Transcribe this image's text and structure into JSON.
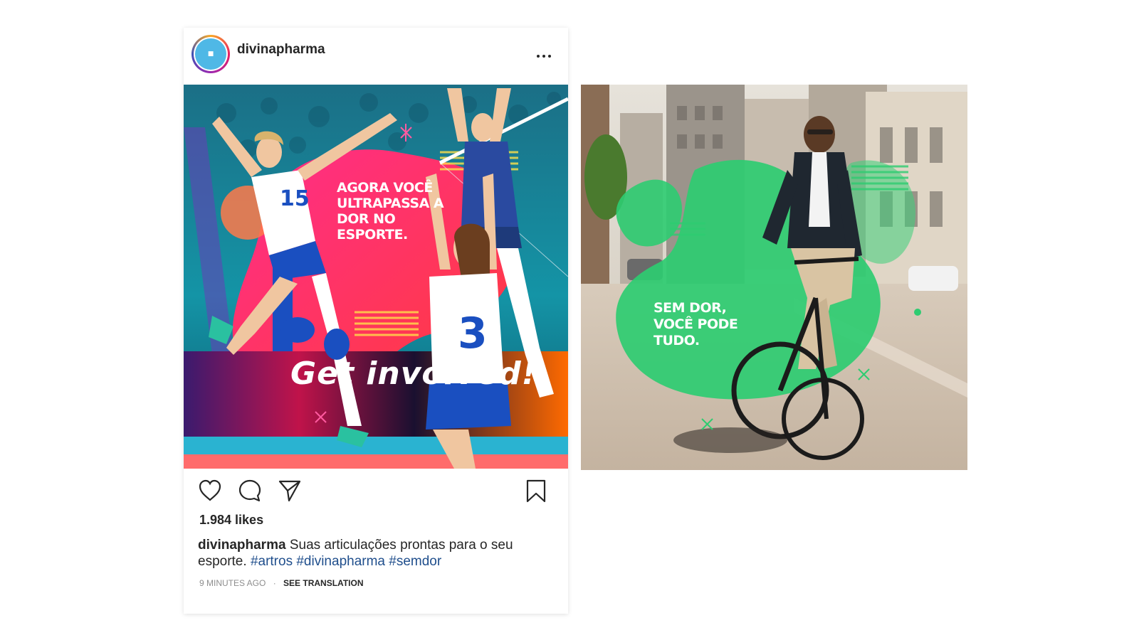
{
  "post": {
    "username": "divinapharma",
    "avatar_text": "■",
    "image_headline": "AGORA VOCÊ ULTRAPASSA A DOR NO ESPORTE.",
    "image_banner": "Get involved!",
    "likes": "1.984 likes",
    "caption_user": "divinapharma",
    "caption_text": "Suas articulações prontas para o seu esporte.",
    "hashtags": [
      "#artros",
      "#divinapharma",
      "#semdor"
    ],
    "time_ago": "9 MINUTES AGO",
    "separator": "·",
    "see_translation": "SEE TRANSLATION"
  },
  "second_image": {
    "headline": "SEM DOR, VOCÊ PODE TUDO."
  },
  "icons": {
    "like": "heart-icon",
    "comment": "comment-icon",
    "share": "paper-plane-icon",
    "save": "bookmark-icon",
    "more": "more-options-icon"
  },
  "colors": {
    "text_primary": "#262626",
    "text_secondary": "#8e8e8e",
    "hashtag": "#1f4e8c",
    "pink_blob": "#ff1f7a",
    "green_blob": "#2ecc71",
    "avatar_bg": "#4fb8e6"
  }
}
